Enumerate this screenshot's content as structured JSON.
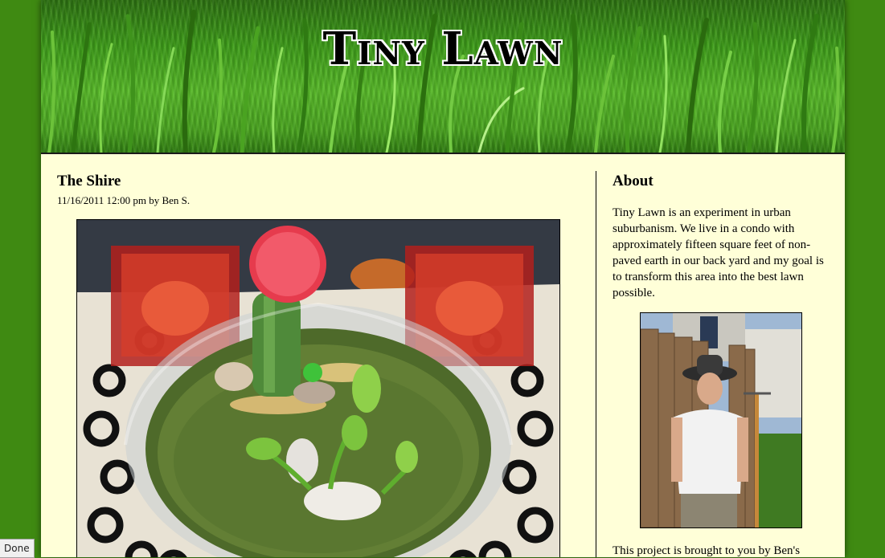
{
  "site": {
    "title": "Tiny Lawn"
  },
  "post": {
    "title": "The Shire",
    "meta": "11/16/2011 12:00 pm by Ben S."
  },
  "sidebar": {
    "heading": "About",
    "about_text": "Tiny Lawn is an experiment in urban suburbanism.  We live in a condo with approximately fifteen square feet of non-paved earth in our back yard and my goal is to transform this area into the best lawn possible.",
    "more_text": "This project is brought to you by Ben's"
  },
  "statusbar": {
    "text": "Done"
  },
  "colors": {
    "page_background": "#3f8a12",
    "content_background": "#ffffd8",
    "grass": "#4aa321"
  }
}
